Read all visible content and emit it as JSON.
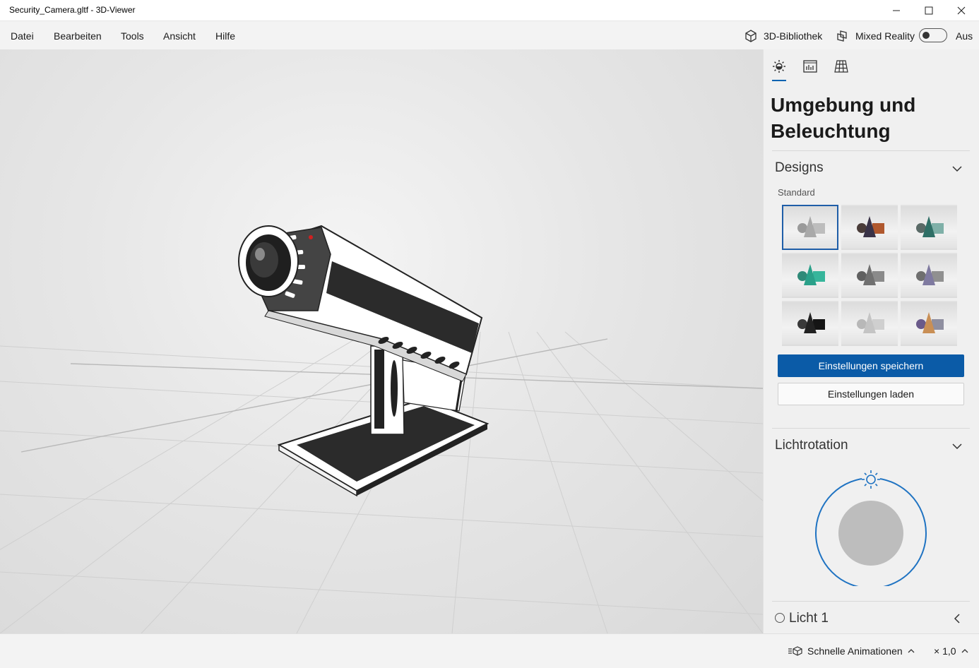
{
  "window": {
    "title": "Security_Camera.gltf - 3D-Viewer"
  },
  "menu": {
    "items": [
      "Datei",
      "Bearbeiten",
      "Tools",
      "Ansicht",
      "Hilfe"
    ]
  },
  "toolbar": {
    "library_label": "3D-Bibliothek",
    "mixed_reality_label": "Mixed Reality",
    "toggle_state": "Aus"
  },
  "panel": {
    "title_line1": "Umgebung und",
    "title_line2": "Beleuchtung",
    "designs": {
      "header": "Designs",
      "group_label": "Standard",
      "themes": [
        {
          "cone": "#a9a9a9",
          "sphere": "#9a9a9a",
          "cube": "#bdbdbd",
          "selected": true
        },
        {
          "cone": "#3a3348",
          "sphere": "#4a3c39",
          "cube": "#b0582e",
          "selected": false
        },
        {
          "cone": "#2f6f66",
          "sphere": "#5a6a67",
          "cube": "#7fb0a8",
          "selected": false
        },
        {
          "cone": "#2aa089",
          "sphere": "#2f8a78",
          "cube": "#36b59b",
          "selected": false
        },
        {
          "cone": "#707070",
          "sphere": "#606060",
          "cube": "#8a8a8a",
          "selected": false
        },
        {
          "cone": "#7f7aa0",
          "sphere": "#6f6f6f",
          "cube": "#909090",
          "selected": false
        },
        {
          "cone": "#222222",
          "sphere": "#3a3a3a",
          "cube": "#151515",
          "selected": false
        },
        {
          "cone": "#c4c4c4",
          "sphere": "#b8b8b8",
          "cube": "#cfcfcf",
          "selected": false
        },
        {
          "cone": "#c98f55",
          "sphere": "#6a5a8a",
          "cube": "#8f8fa0",
          "selected": false
        }
      ],
      "save_label": "Einstellungen speichern",
      "load_label": "Einstellungen laden"
    },
    "light_rotation": {
      "header": "Lichtrotation"
    },
    "light1_label": "Licht 1"
  },
  "statusbar": {
    "animation_label": "Schnelle Animationen",
    "speed_label": "× 1,0"
  },
  "colors": {
    "accent": "#0b5ba7",
    "viewport_bg": "#e6e6e6",
    "panel_bg": "#f0f0f0"
  },
  "icons": {
    "window": [
      "minimize-icon",
      "maximize-icon",
      "close-icon"
    ],
    "panel_tabs": [
      "sun-icon",
      "stats-icon",
      "grid-icon"
    ]
  }
}
